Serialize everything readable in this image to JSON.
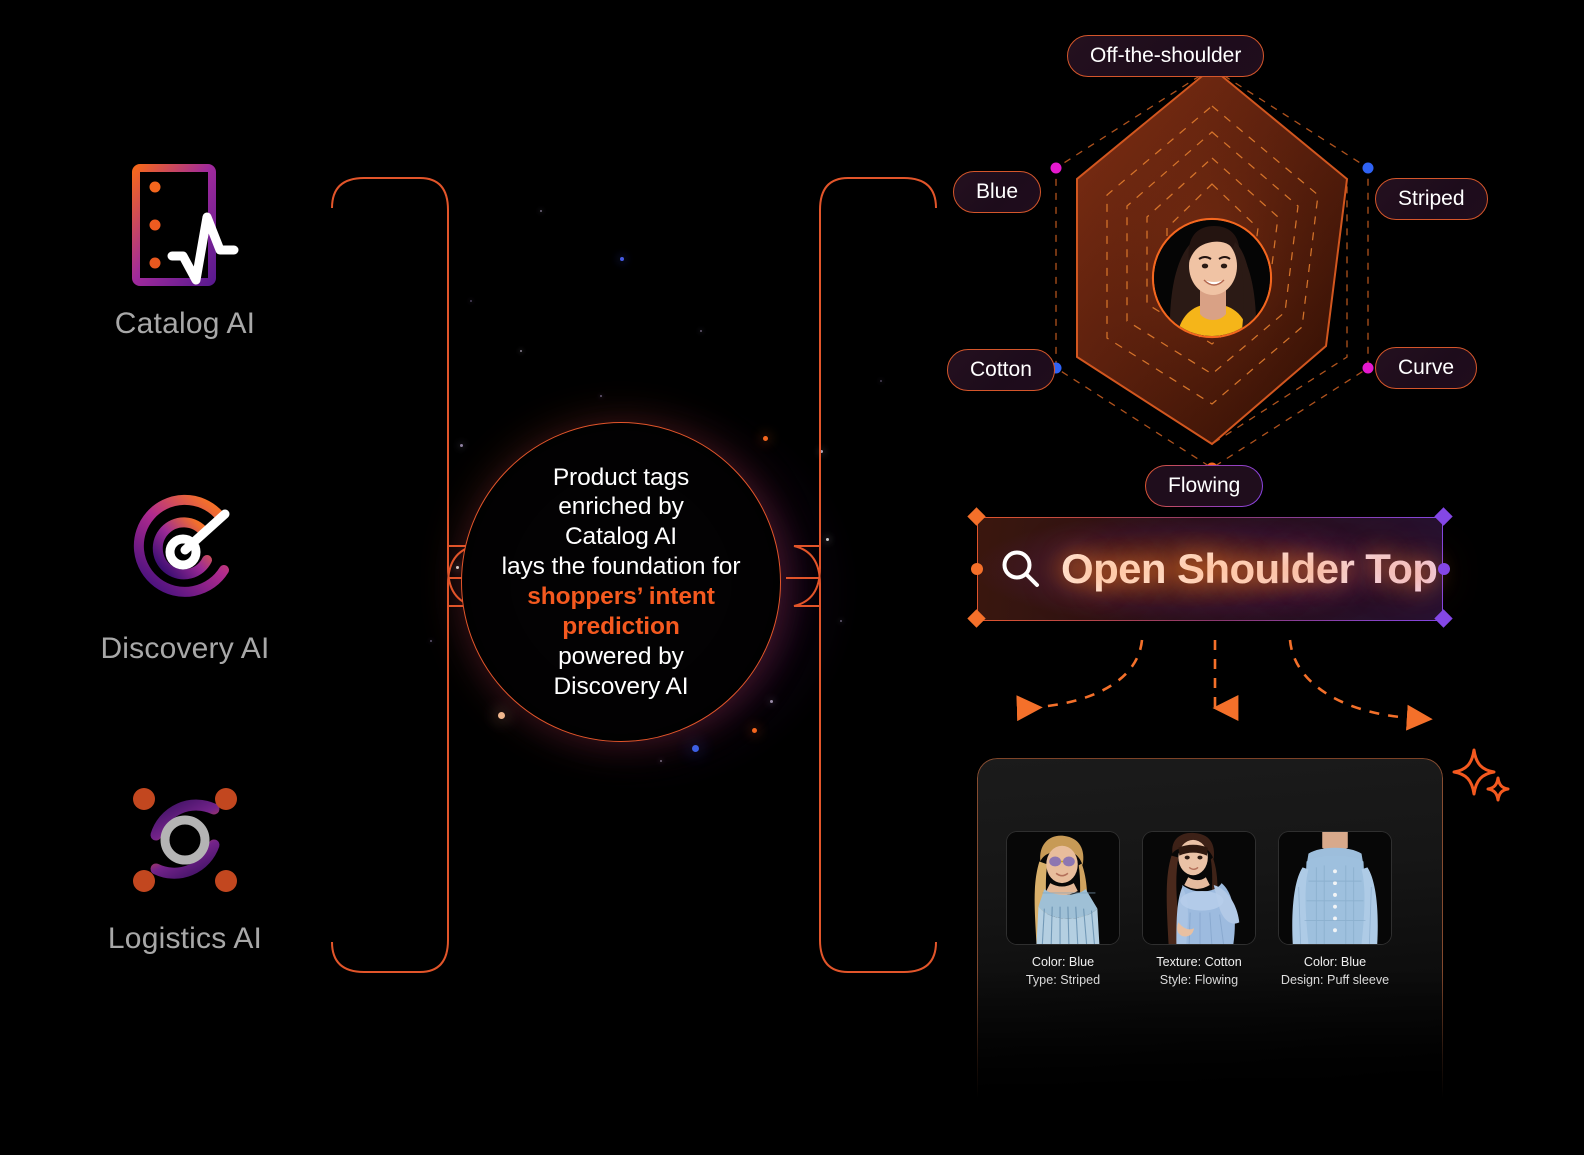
{
  "features": [
    {
      "label": "Catalog AI",
      "icon": "catalog-ai-icon"
    },
    {
      "label": "Discovery AI",
      "icon": "discovery-ai-icon"
    },
    {
      "label": "Logistics AI",
      "icon": "logistics-ai-icon"
    }
  ],
  "core": {
    "line1": "Product tags",
    "line2": "enriched by",
    "line3": "Catalog AI",
    "line4": "lays the foundation for",
    "highlight1": "shoppers’ intent",
    "highlight2": "prediction",
    "line5": "powered by",
    "line6": "Discovery AI"
  },
  "radar": {
    "labels": {
      "top": "Off-the-shoulder",
      "upper_left": "Blue",
      "upper_right": "Striped",
      "lower_left": "Cotton",
      "lower_right": "Curve",
      "bottom": "Flowing"
    },
    "vertex_colors": {
      "top": "#f4671f",
      "upper_left": "#e619cf",
      "upper_right": "#2f63f5",
      "lower_left": "#2f63f5",
      "lower_right": "#e619cf",
      "bottom": "#f4671f"
    }
  },
  "search": {
    "query": "Open Shoulder Top",
    "icon": "search-icon"
  },
  "results": [
    {
      "line1": "Color: Blue",
      "line2": "Type: Striped",
      "thumb": "off-shoulder-striped-dress"
    },
    {
      "line1": "Texture: Cotton",
      "line2": "Style: Flowing",
      "thumb": "off-shoulder-flowing-top"
    },
    {
      "line1": "Color: Blue",
      "line2": "Design: Puff sleeve",
      "thumb": "off-shoulder-puff-sleeve-top"
    }
  ],
  "colors": {
    "accent_orange": "#f4591f",
    "line_orange": "#e2552a",
    "purple": "#8447e6",
    "magenta": "#e619cf",
    "blue": "#2f63f5",
    "caption_gray": "#a8a8a8"
  },
  "decor": {
    "sparkle": "sparkle-icon"
  }
}
